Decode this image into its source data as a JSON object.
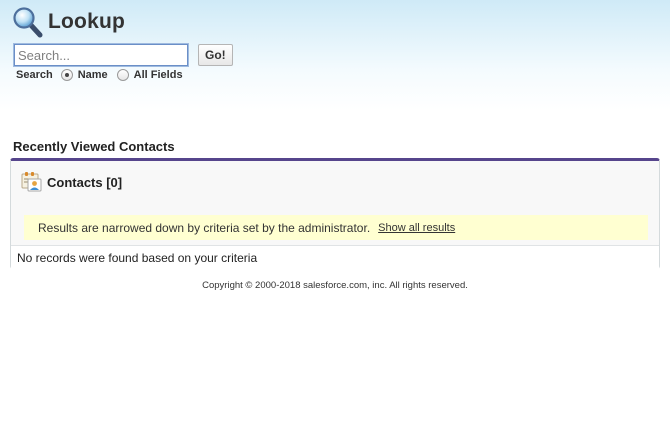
{
  "header": {
    "title": "Lookup",
    "icon": "magnifier-icon"
  },
  "search": {
    "placeholder": "Search...",
    "value": "",
    "go_label": "Go!"
  },
  "scope": {
    "label": "Search",
    "options": [
      {
        "label": "Name",
        "checked": true
      },
      {
        "label": "All Fields",
        "checked": false
      }
    ]
  },
  "section": {
    "title": "Recently Viewed Contacts"
  },
  "results": {
    "heading": "Contacts [0]",
    "notice_text": "Results are narrowed down by criteria set by the administrator.",
    "notice_link": "Show all results",
    "empty_message": "No records were found based on your criteria"
  },
  "footer": {
    "copyright": "Copyright © 2000-2018 salesforce.com, inc. All rights reserved."
  },
  "colors": {
    "accent_bar": "#56458c",
    "notice_bg": "#ffffd1",
    "header_gradient_top": "#cfeaf7"
  }
}
